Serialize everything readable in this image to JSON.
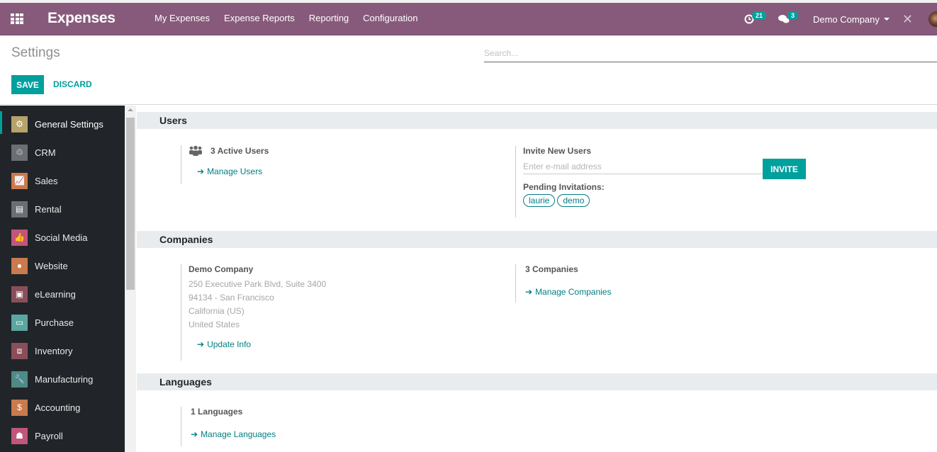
{
  "navbar": {
    "app_name": "Expenses",
    "menu": [
      "My Expenses",
      "Expense Reports",
      "Reporting",
      "Configuration"
    ],
    "activity_count": "21",
    "messages_count": "3",
    "company": "Demo Company",
    "bg_color": "#875a7b"
  },
  "control": {
    "title": "Settings",
    "save_label": "SAVE",
    "discard_label": "DISCARD",
    "search_placeholder": "Search...",
    "search_value": ""
  },
  "sidebar": {
    "items": [
      {
        "label": "General Settings",
        "icon": "gear-icon",
        "color": "#b5a36a",
        "active": true
      },
      {
        "label": "CRM",
        "icon": "handshake-icon",
        "color": "#6b6f73"
      },
      {
        "label": "Sales",
        "icon": "chart-icon",
        "color": "#c97a4e"
      },
      {
        "label": "Rental",
        "icon": "rental-icon",
        "color": "#6b6f73"
      },
      {
        "label": "Social Media",
        "icon": "thumbs-up-icon",
        "color": "#c2557a"
      },
      {
        "label": "Website",
        "icon": "globe-icon",
        "color": "#c97a4e"
      },
      {
        "label": "eLearning",
        "icon": "elearning-icon",
        "color": "#8a4e5a"
      },
      {
        "label": "Purchase",
        "icon": "credit-card-icon",
        "color": "#5aa6a0"
      },
      {
        "label": "Inventory",
        "icon": "box-icon",
        "color": "#8a4e5a"
      },
      {
        "label": "Manufacturing",
        "icon": "wrench-icon",
        "color": "#4e8a86"
      },
      {
        "label": "Accounting",
        "icon": "invoice-icon",
        "color": "#c97a4e"
      },
      {
        "label": "Payroll",
        "icon": "payroll-icon",
        "color": "#c2557a"
      }
    ]
  },
  "users": {
    "heading": "Users",
    "active_users": "3 Active Users",
    "manage_users": "Manage Users",
    "invite_heading": "Invite New Users",
    "email_placeholder": "Enter e-mail address",
    "invite_label": "INVITE",
    "pending_label": "Pending Invitations:",
    "pending": [
      "laurie",
      "demo"
    ]
  },
  "companies": {
    "heading": "Companies",
    "company_name": "Demo Company",
    "address": [
      "250 Executive Park Blvd, Suite 3400",
      "94134 - San Francisco",
      "California (US)",
      "United States"
    ],
    "update_info": "Update Info",
    "count": "3 Companies",
    "manage": "Manage Companies"
  },
  "languages": {
    "heading": "Languages",
    "count": "1 Languages",
    "manage": "Manage Languages"
  }
}
